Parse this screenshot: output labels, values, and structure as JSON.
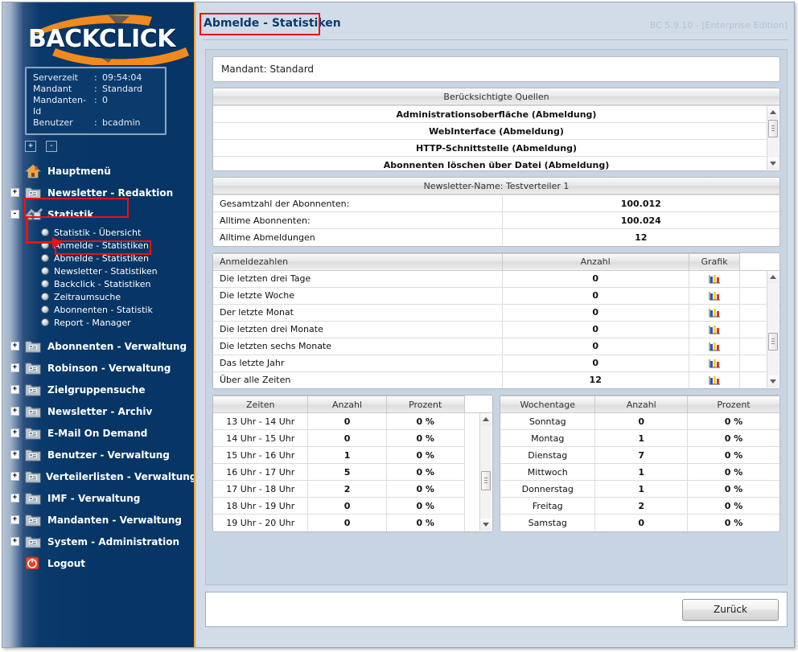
{
  "brand": {
    "logo_text": "BACKCLICK",
    "accent": "#f08a1e",
    "navy": "#063566"
  },
  "server_info": {
    "rows": [
      {
        "key": "Serverzeit",
        "sep": ":",
        "value": "09:54:04"
      },
      {
        "key": "Mandant",
        "sep": ":",
        "value": "Standard"
      },
      {
        "key": "Mandanten-Id",
        "sep": ":",
        "value": "0"
      },
      {
        "key": "Benutzer",
        "sep": ":",
        "value": "bcadmin"
      }
    ]
  },
  "tree_toggles": {
    "expand_all": "+",
    "collapse_all": "-"
  },
  "sidebar": {
    "items": [
      {
        "label": "Hauptmenü",
        "icon": "home-icon",
        "toggle": "",
        "selected": false
      },
      {
        "label": "Newsletter - Redaktion",
        "icon": "folder-icon",
        "toggle": "+",
        "selected": false
      },
      {
        "label": "Statistik",
        "icon": "statistics-icon",
        "toggle": "-",
        "selected": true
      }
    ],
    "statistik_children": [
      {
        "label": "Statistik - Übersicht",
        "selected": false
      },
      {
        "label": "Anmelde - Statistiken",
        "selected": false
      },
      {
        "label": "Abmelde - Statistiken",
        "selected": true
      },
      {
        "label": "Newsletter - Statistiken",
        "selected": false
      },
      {
        "label": "Backclick - Statistiken",
        "selected": false
      },
      {
        "label": "Zeitraumsuche",
        "selected": false
      },
      {
        "label": "Abonnenten - Statistik",
        "selected": false
      },
      {
        "label": "Report - Manager",
        "selected": false
      }
    ],
    "items_after": [
      {
        "label": "Abonnenten - Verwaltung",
        "icon": "folder-icon",
        "toggle": "+"
      },
      {
        "label": "Robinson - Verwaltung",
        "icon": "folder-icon",
        "toggle": "+"
      },
      {
        "label": "Zielgruppensuche",
        "icon": "folder-icon",
        "toggle": "+"
      },
      {
        "label": "Newsletter - Archiv",
        "icon": "folder-icon",
        "toggle": "+"
      },
      {
        "label": "E-Mail On Demand",
        "icon": "folder-icon",
        "toggle": "+"
      },
      {
        "label": "Benutzer - Verwaltung",
        "icon": "folder-icon",
        "toggle": "+"
      },
      {
        "label": "Verteilerlisten - Verwaltung",
        "icon": "folder-icon",
        "toggle": "+"
      },
      {
        "label": "IMF - Verwaltung",
        "icon": "folder-icon",
        "toggle": "+"
      },
      {
        "label": "Mandanten - Verwaltung",
        "icon": "folder-icon",
        "toggle": "+"
      },
      {
        "label": "System - Administration",
        "icon": "folder-icon",
        "toggle": "+"
      },
      {
        "label": "Logout",
        "icon": "logout-icon",
        "toggle": ""
      }
    ]
  },
  "header": {
    "title": "Abmelde - Statistiken",
    "version": "BC 5.9.10 - [Enterprise Edition]"
  },
  "mandant": {
    "text": "Mandant: Standard"
  },
  "sources": {
    "header": "Berücksichtigte Quellen",
    "rows": [
      "Administrationsoberfläche (Abmeldung)",
      "WebInterface (Abmeldung)",
      "HTTP-Schnittstelle (Abmeldung)",
      "Abonnenten löschen über Datei (Abmeldung)"
    ]
  },
  "newsletter": {
    "header": "Newsletter-Name:  Testverteiler 1",
    "rows": [
      {
        "label": "Gesamtzahl der Abonnenten:",
        "value": "100.012"
      },
      {
        "label": "Alltime Abonnenten:",
        "value": "100.024"
      },
      {
        "label": "Alltime Abmeldungen",
        "value": "12"
      }
    ]
  },
  "anmeldezahlen": {
    "columns": [
      "Anmeldezahlen",
      "Anzahl",
      "Grafik"
    ],
    "rows": [
      {
        "label": "Die letzten drei Tage",
        "count": "0",
        "graph": "bar-chart-icon"
      },
      {
        "label": "Die letzte Woche",
        "count": "0",
        "graph": "bar-chart-icon"
      },
      {
        "label": "Der letzte Monat",
        "count": "0",
        "graph": "bar-chart-icon"
      },
      {
        "label": "Die letzten drei Monate",
        "count": "0",
        "graph": "bar-chart-icon"
      },
      {
        "label": "Die letzten sechs Monate",
        "count": "0",
        "graph": "bar-chart-icon"
      },
      {
        "label": "Das letzte Jahr",
        "count": "0",
        "graph": "bar-chart-icon"
      },
      {
        "label": "Über alle Zeiten",
        "count": "12",
        "graph": "bar-chart-icon"
      }
    ]
  },
  "zeiten": {
    "columns": [
      "Zeiten",
      "Anzahl",
      "Prozent"
    ],
    "rows": [
      {
        "label": "13 Uhr - 14 Uhr",
        "count": "0",
        "percent": "0 %"
      },
      {
        "label": "14 Uhr - 15 Uhr",
        "count": "0",
        "percent": "0 %"
      },
      {
        "label": "15 Uhr - 16 Uhr",
        "count": "1",
        "percent": "0 %"
      },
      {
        "label": "16 Uhr - 17 Uhr",
        "count": "5",
        "percent": "0 %"
      },
      {
        "label": "17 Uhr - 18 Uhr",
        "count": "2",
        "percent": "0 %"
      },
      {
        "label": "18 Uhr - 19 Uhr",
        "count": "0",
        "percent": "0 %"
      },
      {
        "label": "19 Uhr - 20 Uhr",
        "count": "0",
        "percent": "0 %"
      }
    ]
  },
  "wochentage": {
    "columns": [
      "Wochentage",
      "Anzahl",
      "Prozent"
    ],
    "rows": [
      {
        "label": "Sonntag",
        "count": "0",
        "percent": "0 %"
      },
      {
        "label": "Montag",
        "count": "1",
        "percent": "0 %"
      },
      {
        "label": "Dienstag",
        "count": "7",
        "percent": "0 %"
      },
      {
        "label": "Mittwoch",
        "count": "1",
        "percent": "0 %"
      },
      {
        "label": "Donnerstag",
        "count": "1",
        "percent": "0 %"
      },
      {
        "label": "Freitag",
        "count": "2",
        "percent": "0 %"
      },
      {
        "label": "Samstag",
        "count": "0",
        "percent": "0 %"
      }
    ]
  },
  "footer": {
    "back_button": "Zurück"
  },
  "annotation": {
    "color": "#ee1111"
  }
}
